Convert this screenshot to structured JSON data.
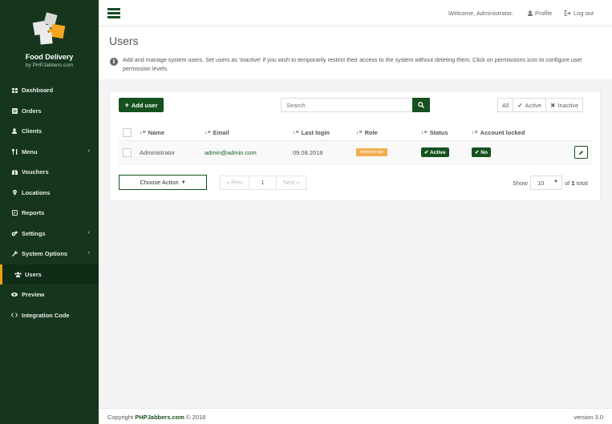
{
  "sidebar": {
    "brand_title": "Food Delivery",
    "brand_sub": "by PHPJabbers.com",
    "items": [
      {
        "label": "Dashboard",
        "icon": "dashboard-icon"
      },
      {
        "label": "Orders",
        "icon": "orders-icon"
      },
      {
        "label": "Clients",
        "icon": "user-icon"
      },
      {
        "label": "Menu",
        "icon": "cutlery-icon"
      },
      {
        "label": "Vouchers",
        "icon": "voucher-icon"
      },
      {
        "label": "Locations",
        "icon": "map-marker-icon"
      },
      {
        "label": "Reports",
        "icon": "reports-icon"
      },
      {
        "label": "Settings",
        "icon": "gear-icon"
      },
      {
        "label": "System Options",
        "icon": "wrench-icon"
      },
      {
        "label": "Users",
        "icon": "users-icon"
      },
      {
        "label": "Preview",
        "icon": "eye-icon"
      },
      {
        "label": "Integration Code",
        "icon": "code-icon"
      }
    ],
    "active": "Users",
    "accent_color": "#f39c12",
    "background_color": "#15361d"
  },
  "topbar": {
    "welcome": "Welcome, Administrator.",
    "profile": "Profile",
    "logout": "Log out"
  },
  "page": {
    "title": "Users",
    "info": "Add and manage system users. Set users as 'Inactive' if you wish to temporarily restrict their access to the system without deleting them. Click on permissions icon to configure user permission levels."
  },
  "toolbar": {
    "add_user": "Add user",
    "search_placeholder": "Search",
    "filter_all": "All",
    "filter_active": "Active",
    "filter_inactive": "Inactive"
  },
  "table": {
    "headers": {
      "name": "Name",
      "email": "Email",
      "last_login": "Last login",
      "role": "Role",
      "status": "Status",
      "locked": "Account locked"
    },
    "rows": [
      {
        "name": "Administrator",
        "email": "admin@admin.com",
        "last_login": "09.08.2018",
        "role": "Administrator",
        "status": "Active",
        "locked": "No"
      }
    ]
  },
  "footer_controls": {
    "choose_action": "Choose Action",
    "prev": "« Prev",
    "page": "1",
    "next": "Next »",
    "show_label": "Show",
    "per_page": "10",
    "of_label": "of",
    "total_count": "1",
    "total_label": "total"
  },
  "footer": {
    "copyright_prefix": "Copyright",
    "copyright_link": "PHPJabbers.com",
    "copyright_suffix": "© 2018",
    "version": "version 3.0"
  },
  "colors": {
    "primary_green": "#15521f",
    "role_badge": "#f0ad4e"
  }
}
